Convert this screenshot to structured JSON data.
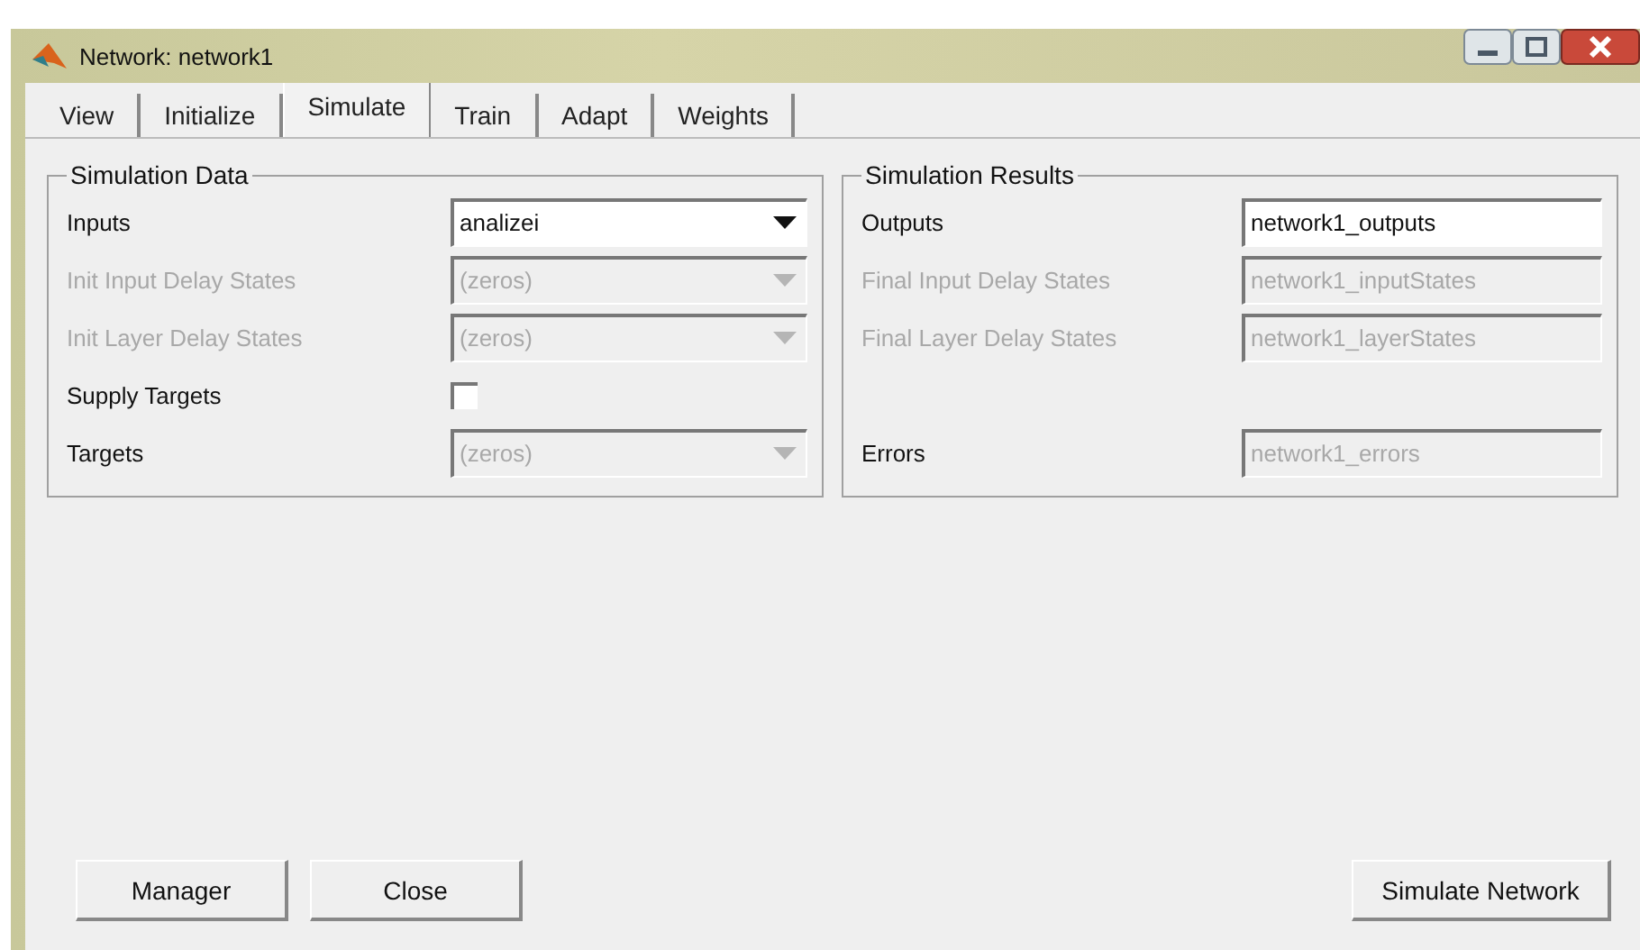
{
  "window": {
    "title": "Network: network1"
  },
  "tabs": [
    {
      "label": "View",
      "selected": false
    },
    {
      "label": "Initialize",
      "selected": false
    },
    {
      "label": "Simulate",
      "selected": true
    },
    {
      "label": "Train",
      "selected": false
    },
    {
      "label": "Adapt",
      "selected": false
    },
    {
      "label": "Weights",
      "selected": false
    }
  ],
  "panels": [
    {
      "title": "Simulation Data",
      "rows": [
        {
          "kind": "dropdown",
          "label": "Inputs",
          "label_disabled": false,
          "value": "analizei",
          "disabled": false
        },
        {
          "kind": "dropdown",
          "label": "Init Input Delay States",
          "label_disabled": true,
          "value": "(zeros)",
          "disabled": true
        },
        {
          "kind": "dropdown",
          "label": "Init Layer Delay States",
          "label_disabled": true,
          "value": "(zeros)",
          "disabled": true
        },
        {
          "kind": "checkbox",
          "label": "Supply Targets",
          "label_disabled": false,
          "checked": false
        },
        {
          "kind": "dropdown",
          "label": "Targets",
          "label_disabled": false,
          "value": "(zeros)",
          "disabled": true
        }
      ]
    },
    {
      "title": "Simulation Results",
      "rows": [
        {
          "kind": "text",
          "label": "Outputs",
          "label_disabled": false,
          "value": "network1_outputs",
          "disabled": false
        },
        {
          "kind": "text",
          "label": "Final Input Delay States",
          "label_disabled": true,
          "value": "network1_inputStates",
          "disabled": true
        },
        {
          "kind": "text",
          "label": "Final Layer Delay States",
          "label_disabled": true,
          "value": "network1_layerStates",
          "disabled": true
        },
        {
          "kind": "blank"
        },
        {
          "kind": "text",
          "label": "Errors",
          "label_disabled": false,
          "value": "network1_errors",
          "disabled": true
        }
      ]
    }
  ],
  "buttons_left": [
    "Manager",
    "Close"
  ],
  "buttons_right": [
    "Simulate Network"
  ]
}
